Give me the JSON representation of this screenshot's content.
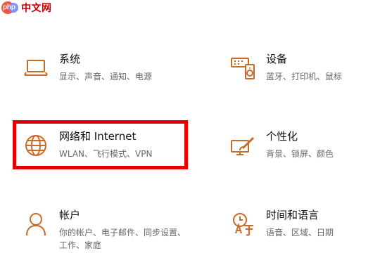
{
  "watermark": {
    "logo_text": "php",
    "text": "中文网"
  },
  "settings": {
    "system": {
      "title": "系统",
      "desc": "显示、声音、通知、电源",
      "icon": "laptop-icon"
    },
    "devices": {
      "title": "设备",
      "desc": "蓝牙、打印机、鼠标",
      "icon": "devices-icon"
    },
    "network": {
      "title": "网络和 Internet",
      "desc": "WLAN、飞行模式、VPN",
      "icon": "globe-icon"
    },
    "personalization": {
      "title": "个性化",
      "desc": "背景、锁屏、颜色",
      "icon": "paint-brush-icon"
    },
    "accounts": {
      "title": "帐户",
      "desc": "你的帐户、电子邮件、同步设置、工作、家庭",
      "icon": "user-icon"
    },
    "time_language": {
      "title": "时间和语言",
      "desc": "语音、区域、日期",
      "icon": "time-language-icon"
    }
  },
  "colors": {
    "icon_accent": "#c86a2a",
    "highlight": "#e30000",
    "title_text": "#111111",
    "desc_text": "#666666"
  }
}
